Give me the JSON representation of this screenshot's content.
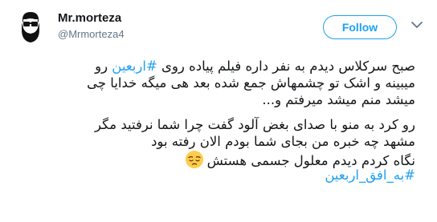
{
  "user": {
    "display_name": "Mr.morteza",
    "handle": "@Mrmorteza4"
  },
  "follow_label": "Follow",
  "tweet": {
    "line1_before": "صبح سرکلاس دیدم به نفر داره فیلم پیاده روی ",
    "line1_hashtag": "#اربعین",
    "line1_after": " رو",
    "line2": "میبینه و اشک تو  چشمهاش جمع شده بعد هی میگه خدایا چی",
    "line3": "میشد منم میشد میرفتم و...",
    "line4": "رو کرد به منو با صدای بغض آلود گفت چرا شما نرفتید مگر",
    "line5": "مشهد چه خبره من بجای شما بودم الان رفته بود",
    "line6": "نگاه کردم دیدم معلول جسمی هستش",
    "emoji": "pensive-face",
    "hashtag2": "#به_افق_اربعین"
  },
  "colors": {
    "accent": "#1da1f2",
    "text": "#14171a",
    "secondary": "#657786"
  }
}
